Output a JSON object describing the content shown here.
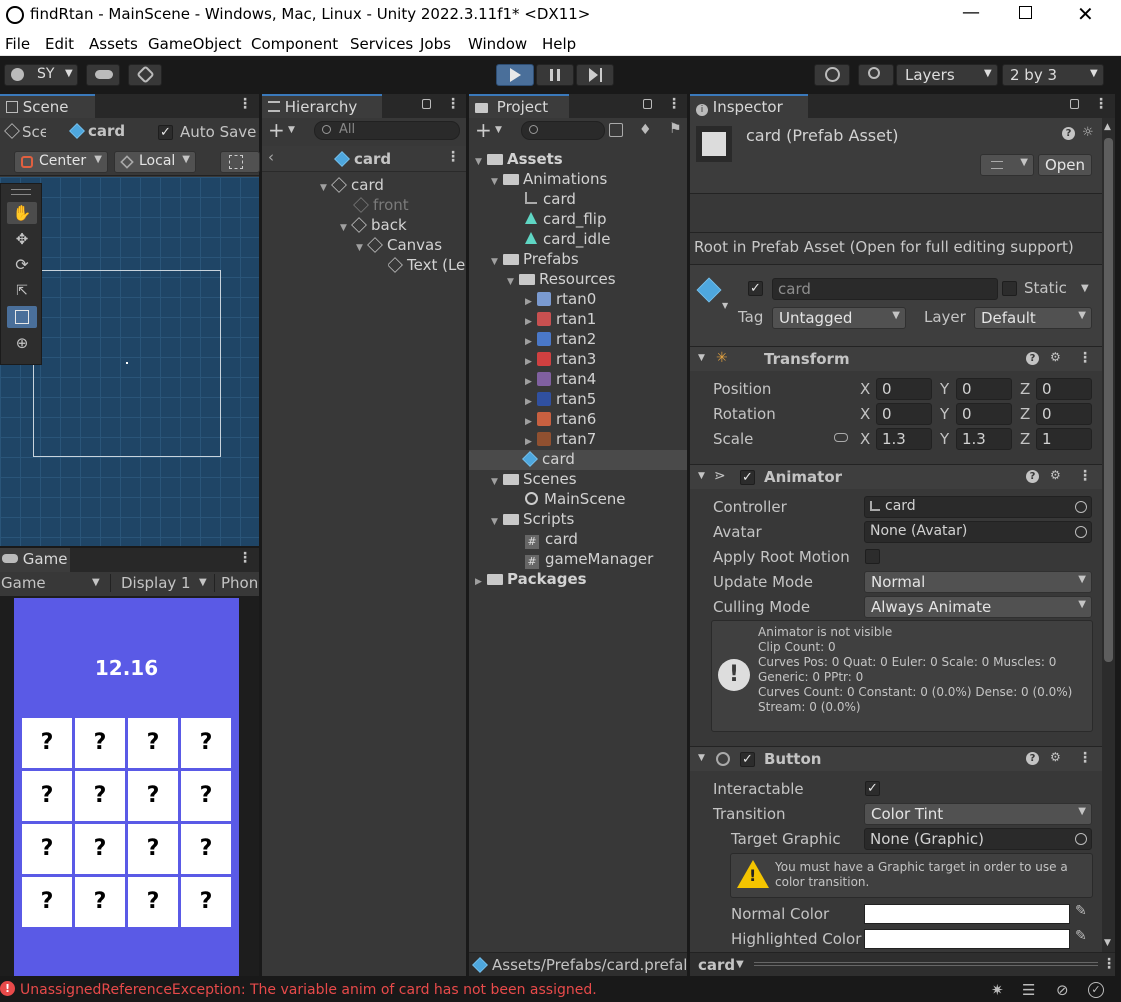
{
  "window": {
    "title": "findRtan - MainScene - Windows, Mac, Linux - Unity 2022.3.11f1* <DX11>"
  },
  "menu": [
    "File",
    "Edit",
    "Assets",
    "GameObject",
    "Component",
    "Services",
    "Jobs",
    "Window",
    "Help"
  ],
  "toolbar": {
    "account": "SY",
    "layers": "Layers",
    "layout": "2 by 3"
  },
  "scene": {
    "tab": "Scene",
    "path_scene": "Sce",
    "path_prefab": "card",
    "auto_save": "Auto Save",
    "pivot": "Center",
    "space": "Local"
  },
  "game": {
    "tab": "Game",
    "mode": "Game",
    "display": "Display 1",
    "aspect": "Phone",
    "timer": "12.16",
    "card_symbol": "?",
    "grid_rows": 4,
    "grid_cols": 4
  },
  "hierarchy": {
    "tab": "Hierarchy",
    "search_placeholder": "All",
    "breadcrumb": "card",
    "items": [
      "card",
      "front",
      "back",
      "Canvas",
      "Text (Le"
    ]
  },
  "project": {
    "tab": "Project",
    "tree": {
      "assets": "Assets",
      "animations": "Animations",
      "anim_card": "card",
      "anim_flip": "card_flip",
      "anim_idle": "card_idle",
      "prefabs": "Prefabs",
      "resources": "Resources",
      "rtans": [
        "rtan0",
        "rtan1",
        "rtan2",
        "rtan3",
        "rtan4",
        "rtan5",
        "rtan6",
        "rtan7"
      ],
      "prefab_card": "card",
      "scenes": "Scenes",
      "main_scene": "MainScene",
      "scripts": "Scripts",
      "script_card": "card",
      "script_gm": "gameManager",
      "packages": "Packages"
    },
    "footer_path": "Assets/Prefabs/card.prefal"
  },
  "inspector": {
    "tab": "Inspector",
    "asset_title": "card (Prefab Asset)",
    "open_button": "Open",
    "root_note": "Root in Prefab Asset (Open for full editing support)",
    "name": "card",
    "static": "Static",
    "tag_label": "Tag",
    "tag_value": "Untagged",
    "layer_label": "Layer",
    "layer_value": "Default",
    "transform": {
      "title": "Transform",
      "position_label": "Position",
      "pos": [
        "0",
        "0",
        "0"
      ],
      "rotation_label": "Rotation",
      "rot": [
        "0",
        "0",
        "0"
      ],
      "scale_label": "Scale",
      "scale": [
        "1.3",
        "1.3",
        "1"
      ],
      "x": "X",
      "y": "Y",
      "z": "Z"
    },
    "animator": {
      "title": "Animator",
      "controller_label": "Controller",
      "controller": "card",
      "avatar_label": "Avatar",
      "avatar": "None (Avatar)",
      "apply_root_label": "Apply Root Motion",
      "update_label": "Update Mode",
      "update": "Normal",
      "culling_label": "Culling Mode",
      "culling": "Always Animate",
      "info": [
        "Animator is not visible",
        "Clip Count: 0",
        "Curves Pos: 0 Quat: 0 Euler: 0 Scale: 0 Muscles: 0",
        "Generic: 0 PPtr: 0",
        "Curves Count: 0 Constant: 0 (0.0%) Dense: 0 (0.0%)",
        "Stream: 0 (0.0%)"
      ]
    },
    "button": {
      "title": "Button",
      "interactable_label": "Interactable",
      "transition_label": "Transition",
      "transition": "Color Tint",
      "target_label": "Target Graphic",
      "target": "None (Graphic)",
      "warning": "You must have a Graphic target in order to use a color transition.",
      "normal_label": "Normal Color",
      "highlight_label": "Highlighted Color"
    },
    "footer": "card"
  },
  "status": {
    "error": "UnassignedReferenceException: The variable anim of card has not been assigned."
  },
  "colors": {
    "accent": "#3a79bb",
    "game_bg": "#5a5ae6",
    "scene_bg": "#1f4566",
    "error": "#e84a4a"
  }
}
